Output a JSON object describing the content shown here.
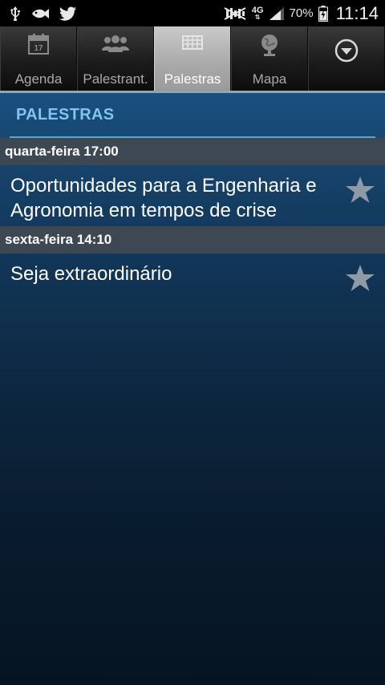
{
  "status_bar": {
    "icons": [
      "usb-icon",
      "fish-icon",
      "twitter-icon",
      "mute-icon",
      "signal-icon",
      "battery-icon"
    ],
    "network": "4G",
    "battery": "70%",
    "time": "11:14"
  },
  "tabs": [
    {
      "label": "Agenda",
      "icon": "calendar-icon",
      "calendar_day": "17",
      "active": false
    },
    {
      "label": "Palestrant.",
      "icon": "people-icon",
      "active": false
    },
    {
      "label": "Palestras",
      "icon": "grid-icon",
      "active": true
    },
    {
      "label": "Mapa",
      "icon": "globe-icon",
      "active": false
    },
    {
      "label": "",
      "icon": "chevron-down-circle-icon",
      "active": false
    }
  ],
  "section": {
    "title": "PALESTRAS"
  },
  "groups": [
    {
      "day": "quarta-feira 17:00",
      "talks": [
        {
          "title": "Oportunidades para a Engenharia e Agronomia em tempos de crise",
          "favorite": false
        }
      ]
    },
    {
      "day": "sexta-feira 14:10",
      "talks": [
        {
          "title": "Seja extraordinário",
          "favorite": false
        }
      ]
    }
  ],
  "colors": {
    "accent": "#7fc4f2",
    "divider": "#5aa5d6",
    "day_header": "#3d4853",
    "star": "#8e9aa6"
  }
}
